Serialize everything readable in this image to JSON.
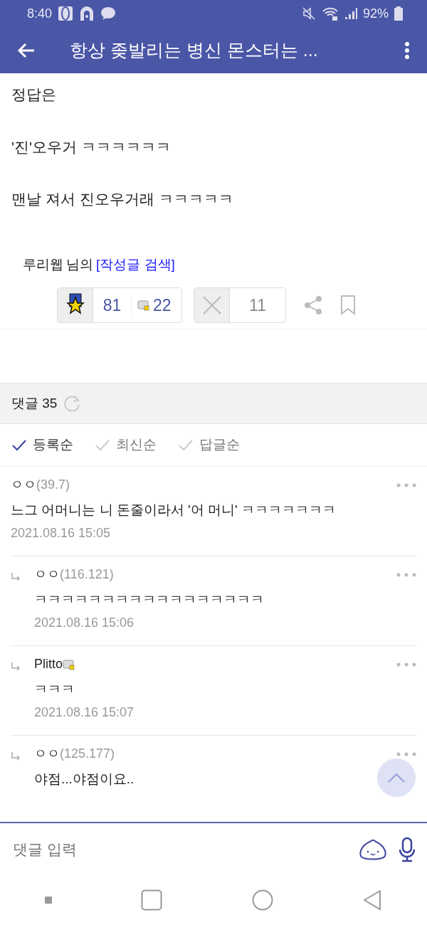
{
  "status_bar": {
    "time": "8:40",
    "battery": "92%"
  },
  "app_bar": {
    "title": "항상 좆발리는 병신 몬스터는 ..."
  },
  "post": {
    "paragraphs": [
      "정답은",
      "'진'오우거 ㅋㅋㅋㅋㅋㅋ",
      "맨날 져서 진오우거래 ㅋㅋㅋㅋㅋ"
    ],
    "author": "루리웹",
    "author_suffix": "님의",
    "search_link": "[작성글 검색]"
  },
  "actions": {
    "upvotes": "81",
    "badge_count": "22",
    "downvotes": "11"
  },
  "comments_header": {
    "label": "댓글 35"
  },
  "sort_tabs": [
    {
      "label": "등록순",
      "selected": true
    },
    {
      "label": "최신순",
      "selected": false
    },
    {
      "label": "답글순",
      "selected": false
    }
  ],
  "comments": [
    {
      "kind": "top",
      "author": "ㅇㅇ",
      "ip": "(39.7)",
      "text": "느그 어머니는 니 돈줄이라서 '어 머니' ㅋㅋㅋㅋㅋㅋㅋ",
      "date": "2021.08.16 15:05"
    },
    {
      "kind": "reply",
      "author": "ㅇㅇ",
      "ip": "(116.121)",
      "text": "ㅋㅋㅋㅋㅋㅋㅋㅋㅋㅋㅋㅋㅋㅋㅋㅋㅋ",
      "date": "2021.08.16 15:06"
    },
    {
      "kind": "reply",
      "author": "Plitto",
      "level_icon": true,
      "text": "ㅋㅋㅋ",
      "date": "2021.08.16 15:07"
    },
    {
      "kind": "reply",
      "author": "ㅇㅇ",
      "ip": "(125.177)",
      "text": "야점...야점이요.."
    }
  ],
  "comment_input": {
    "placeholder": "댓글 입력"
  }
}
